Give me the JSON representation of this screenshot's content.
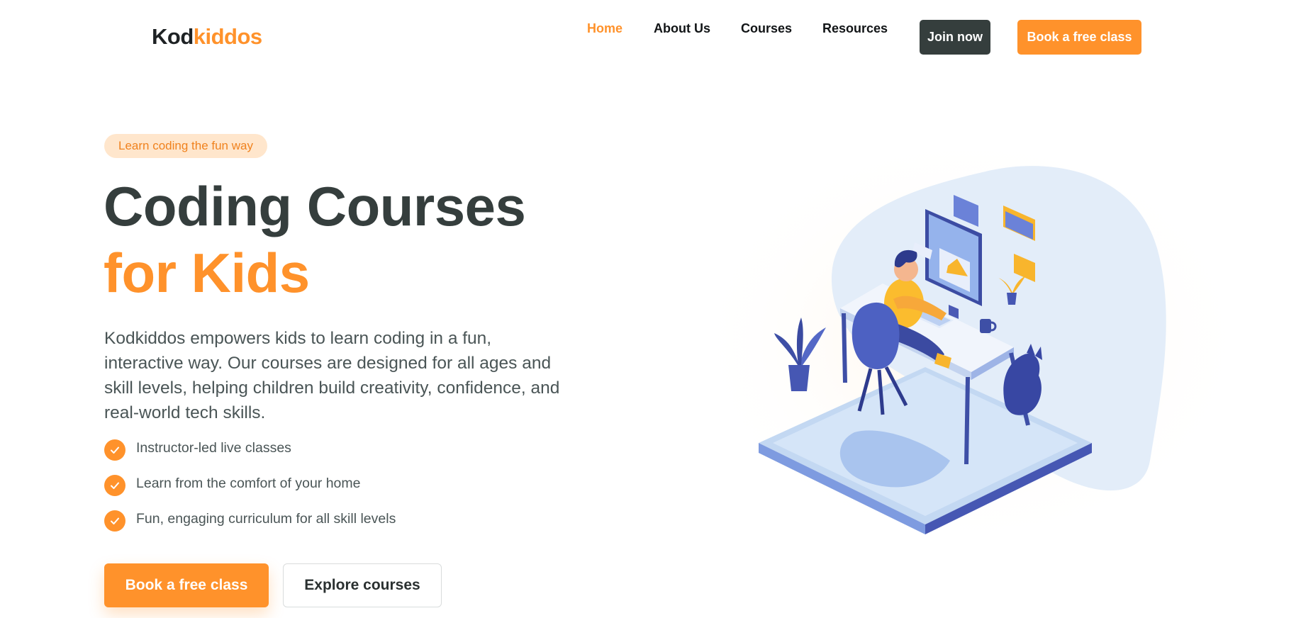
{
  "header": {
    "logo": {
      "part1": "Kod",
      "part2": "kiddos"
    },
    "nav": [
      {
        "label": "Home",
        "active": true
      },
      {
        "label": "About Us",
        "active": false
      },
      {
        "label": "Courses",
        "active": false
      },
      {
        "label": "Resources",
        "active": false
      }
    ],
    "join_label": "Join now",
    "book_label": "Book a free class"
  },
  "hero": {
    "tagline": "Learn coding the fun way",
    "title_line1": "Coding Courses",
    "title_line2": "for Kids",
    "description": "Kodkiddos empowers kids to learn coding in a fun, interactive way. Our courses are designed for all ages and skill levels, helping children build creativity, confidence, and real-world tech skills.",
    "features": [
      "Instructor-led live classes",
      "Learn from the comfort of your home",
      "Fun, engaging curriculum for all skill levels"
    ],
    "primary_cta": "Book a free class",
    "secondary_cta": "Explore courses",
    "illustration": "kid-coding-at-desk-illustration"
  },
  "colors": {
    "accent": "#ff922b",
    "dark": "#353e3d",
    "tagline_bg": "#ffe6cc",
    "blob": "#e3edf9",
    "illustration_blue": "#4657b3"
  }
}
